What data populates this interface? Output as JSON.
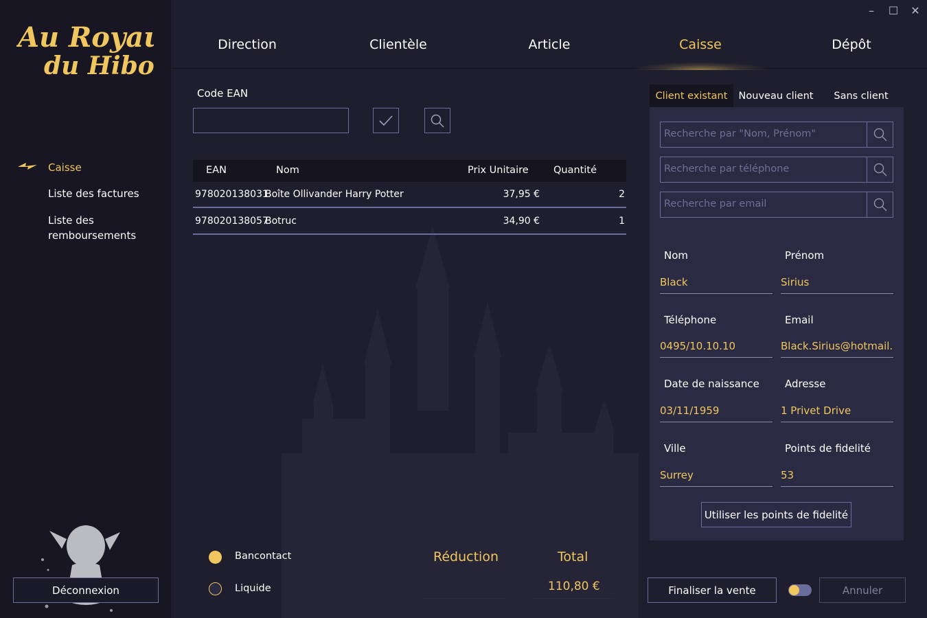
{
  "app": {
    "logo_line1": "Au Royaume",
    "logo_line2": "du Hibou"
  },
  "window_controls": {
    "minimize": "–",
    "maximize": "☐",
    "close": "✕"
  },
  "sidebar": {
    "items": [
      {
        "label": "Caisse",
        "active": true
      },
      {
        "label": "Liste des factures",
        "active": false
      },
      {
        "label": "Liste des remboursements",
        "active": false
      }
    ],
    "logout_label": "Déconnexion"
  },
  "nav": {
    "tabs": [
      {
        "label": "Direction"
      },
      {
        "label": "Clientèle"
      },
      {
        "label": "Article"
      },
      {
        "label": "Caisse"
      },
      {
        "label": "Dépôt"
      }
    ],
    "active_tab": "Caisse"
  },
  "ean": {
    "label": "Code EAN",
    "value": ""
  },
  "table": {
    "headers": [
      "EAN",
      "Nom",
      "Prix Unitaire",
      "Quantité"
    ],
    "rows": [
      {
        "ean": "978020138031",
        "nom": "Boîte Ollivander Harry Potter",
        "prix": "37,95 €",
        "quantite": "2"
      },
      {
        "ean": "978020138057",
        "nom": "Botruc",
        "prix": "34,90 €",
        "quantite": "1"
      }
    ]
  },
  "payment": {
    "options": [
      {
        "label": "Bancontact",
        "selected": true
      },
      {
        "label": "Liquide",
        "selected": false
      }
    ]
  },
  "summary": {
    "reduction_label": "Réduction",
    "reduction_value": "",
    "total_label": "Total",
    "total_value": "110,80 €"
  },
  "actions": {
    "finalize_label": "Finaliser la vente",
    "cancel_label": "Annuler"
  },
  "client_panel": {
    "tabs": [
      {
        "label": "Client existant",
        "active": true
      },
      {
        "label": "Nouveau client",
        "active": false
      },
      {
        "label": "Sans client",
        "active": false
      }
    ],
    "search": {
      "by_name": "Recherche par \"Nom, Prénom\"",
      "by_phone": "Recherche par téléphone",
      "by_email": "Recherche par email"
    },
    "fields": {
      "nom": {
        "label": "Nom",
        "value": "Black"
      },
      "prenom": {
        "label": "Prénom",
        "value": "Sirius"
      },
      "telephone": {
        "label": "Téléphone",
        "value": "0495/10.10.10"
      },
      "email": {
        "label": "Email",
        "value": "Black.Sirius@hotmail.com"
      },
      "naissance": {
        "label": "Date de naissance",
        "value": "03/11/1959"
      },
      "adresse": {
        "label": "Adresse",
        "value": "1 Privet Drive"
      },
      "ville": {
        "label": "Ville",
        "value": "Surrey"
      },
      "points": {
        "label": "Points de fidelité",
        "value": "53"
      }
    },
    "use_points_label": "Utiliser les points de fidelité"
  },
  "colors": {
    "accent": "#f0c75e",
    "background": "#1f1e2e",
    "sidebar": "#171622",
    "panel": "#2b2a43",
    "border": "#6b6e9c"
  }
}
